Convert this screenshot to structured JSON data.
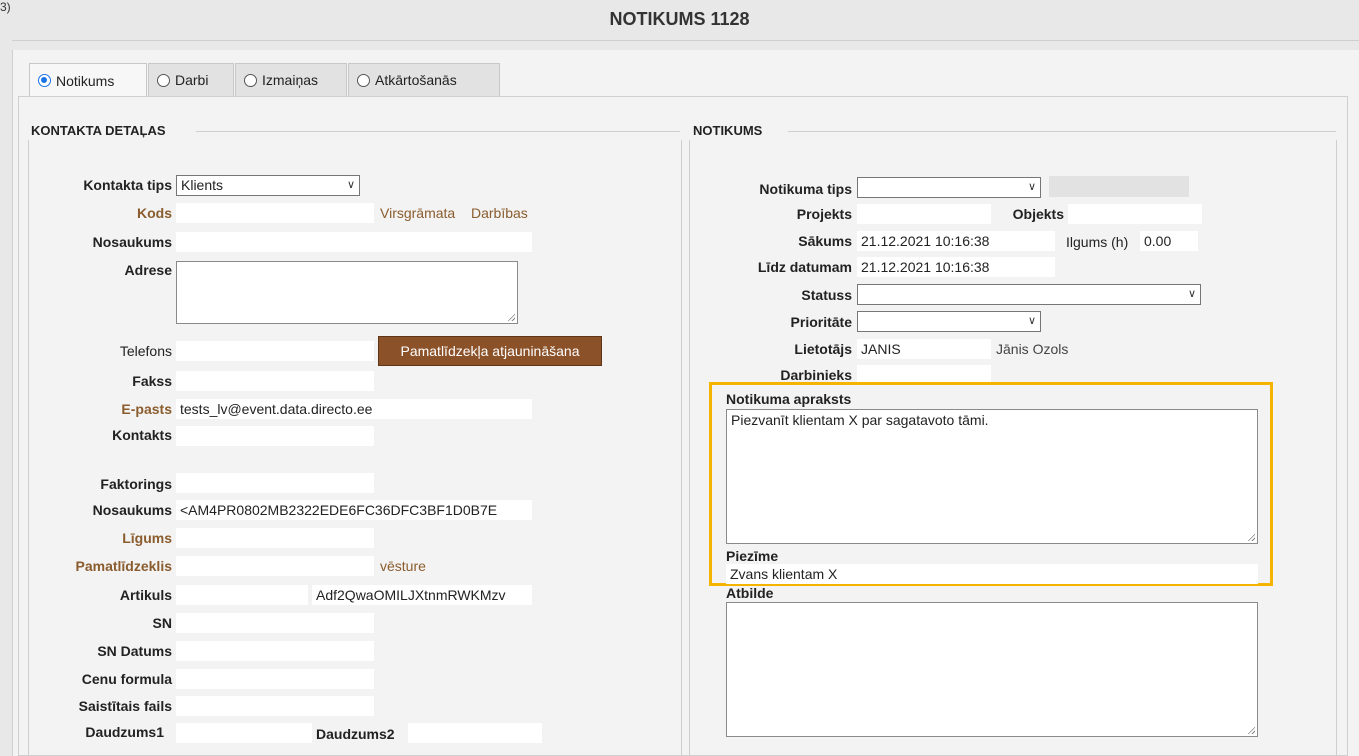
{
  "corner_mark": "3)",
  "title": "NOTIKUMS 1128",
  "tabs": [
    {
      "label": "Notikums",
      "selected": true
    },
    {
      "label": "Darbi",
      "selected": false
    },
    {
      "label": "Izmaiņas",
      "selected": false
    },
    {
      "label": "Atkārtošanās",
      "selected": false
    }
  ],
  "left": {
    "section_title": "KONTAKTA DETAĻAS",
    "kontakta_tips": {
      "label": "Kontakta tips",
      "value": "Klients"
    },
    "kods": {
      "label": "Kods",
      "value": ""
    },
    "virsgramata": "Virsgrāmata",
    "darbibas": "Darbības",
    "nosaukums": {
      "label": "Nosaukums",
      "value": ""
    },
    "adrese": {
      "label": "Adrese",
      "value": ""
    },
    "telefons": {
      "label": "Telefons",
      "value": ""
    },
    "update_button": "Pamatlīdzekļa atjaunināšana",
    "fakss": {
      "label": "Fakss",
      "value": ""
    },
    "epasts": {
      "label": "E-pasts",
      "value": "tests_lv@event.data.directo.ee"
    },
    "kontakts": {
      "label": "Kontakts",
      "value": ""
    },
    "faktorings": {
      "label": "Faktorings",
      "value": ""
    },
    "nosaukums2": {
      "label": "Nosaukums",
      "value": "<AM4PR0802MB2322EDE6FC36DFC3BF1D0B7E"
    },
    "ligums": {
      "label": "Līgums",
      "value": ""
    },
    "pamatlidzeklis": {
      "label": "Pamatlīdzeklis",
      "value": ""
    },
    "vesture": "vēsture",
    "artikuls": {
      "label": "Artikuls",
      "value": "",
      "value2": "Adf2QwaOMILJXtnmRWKMzv"
    },
    "sn": {
      "label": "SN",
      "value": ""
    },
    "sn_datums": {
      "label": "SN Datums",
      "value": ""
    },
    "cenu_formula": {
      "label": "Cenu formula",
      "value": ""
    },
    "saistitais_fails": {
      "label": "Saistītais fails",
      "value": ""
    },
    "daudzums1": {
      "label": "Daudzums1",
      "value": ""
    },
    "daudzums2": {
      "label": "Daudzums2",
      "value": ""
    }
  },
  "right": {
    "section_title": "NOTIKUMS",
    "notikuma_tips": {
      "label": "Notikuma tips",
      "value": ""
    },
    "projekts": {
      "label": "Projekts",
      "value": ""
    },
    "objekts": {
      "label": "Objekts",
      "value": ""
    },
    "sakums": {
      "label": "Sākums",
      "value": "21.12.2021 10:16:38"
    },
    "ilgums": {
      "label": "Ilgums (h)",
      "value": "0.00"
    },
    "lidz_datumam": {
      "label": "Līdz datumam",
      "value": "21.12.2021 10:16:38"
    },
    "statuss": {
      "label": "Statuss",
      "value": ""
    },
    "prioritate": {
      "label": "Prioritāte",
      "value": ""
    },
    "lietotajs": {
      "label": "Lietotājs",
      "value": "JANIS",
      "name": "Jānis Ozols"
    },
    "darbinieks": {
      "label": "Darbinieks",
      "value": ""
    },
    "apraksts": {
      "label": "Notikuma apraksts",
      "value": "Piezvanīt klientam X par sagatavoto tāmi."
    },
    "piezime": {
      "label": "Piezīme",
      "value": "Zvans klientam X"
    },
    "atbilde": {
      "label": "Atbilde",
      "value": ""
    }
  },
  "colors": {
    "link": "#8a5c2e",
    "button": "#8b5128",
    "highlight": "#f5b400",
    "radio_selected": "#1a73e8"
  }
}
